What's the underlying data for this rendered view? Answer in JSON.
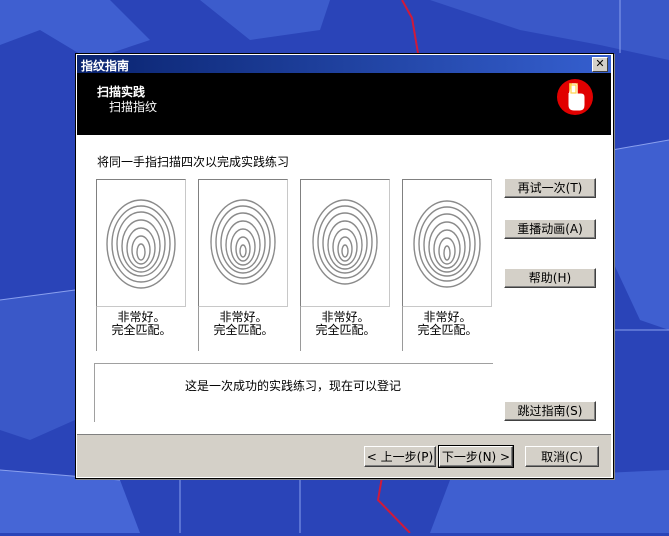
{
  "window": {
    "title": "指纹指南"
  },
  "header": {
    "step_title": "扫描实践",
    "step_subtitle": "扫描指纹"
  },
  "instruction": "将同一手指扫描四次以完成实践练习",
  "prints": [
    {
      "line1": "非常好。",
      "line2": "完全匹配。"
    },
    {
      "line1": "非常好。",
      "line2": "完全匹配。"
    },
    {
      "line1": "非常好。",
      "line2": "完全匹配。"
    },
    {
      "line1": "非常好。",
      "line2": "完全匹配。"
    }
  ],
  "side_buttons": {
    "retry": "再试一次(T)",
    "replay": "重播动画(A)",
    "help": "帮助(H)",
    "skip": "跳过指南(S)"
  },
  "status": "这是一次成功的实践练习，现在可以登记",
  "footer": {
    "back": "< 上一步(P)",
    "next": "下一步(N) >",
    "cancel": "取消(C)"
  },
  "icons": {
    "close": "close-icon",
    "logo": "fingerprint-logo-icon",
    "print": "fingerprint-icon"
  },
  "colors": {
    "desktop": "#2a44b8",
    "header_band": "#000000",
    "logo": "#e10000",
    "titlebar": "#0a2470"
  }
}
